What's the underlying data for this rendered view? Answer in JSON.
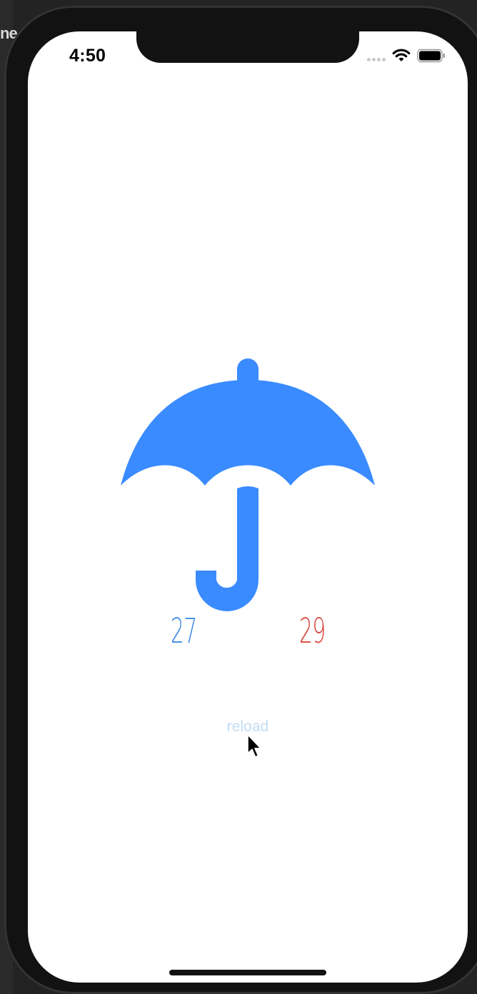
{
  "status_bar": {
    "time": "4:50",
    "wifi_icon": "wifi-icon",
    "battery_icon": "battery-icon",
    "signal_icon": "signal-dots-icon"
  },
  "desktop": {
    "edge_text": "ne"
  },
  "weather": {
    "icon": "umbrella-icon",
    "icon_color": "#3a8bff",
    "temp_low": "27",
    "temp_low_color": "#3f8be6",
    "temp_high": "29",
    "temp_high_color": "#d7453c"
  },
  "actions": {
    "reload_label": "reload"
  }
}
